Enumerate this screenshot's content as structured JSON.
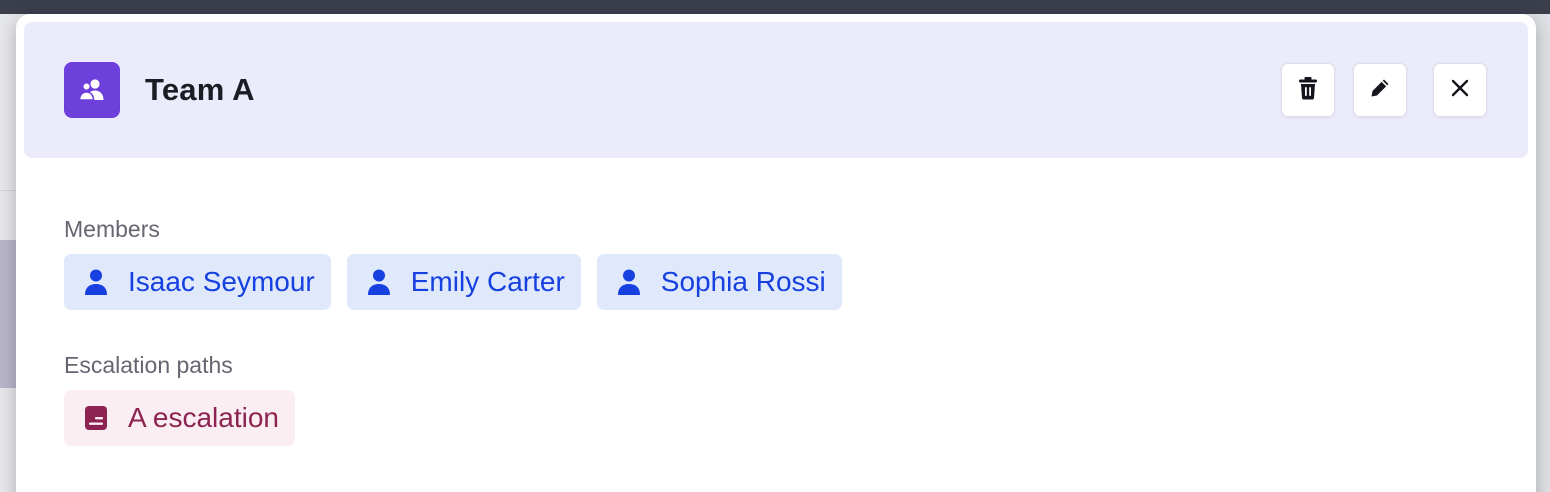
{
  "team": {
    "name": "Team A",
    "icon": "team-users-icon"
  },
  "header_actions": {
    "delete_icon": "trash-icon",
    "edit_icon": "pencil-icon",
    "close_icon": "close-icon"
  },
  "members": {
    "label": "Members",
    "items": [
      {
        "name": "Isaac Seymour",
        "icon": "user-icon"
      },
      {
        "name": "Emily Carter",
        "icon": "user-icon"
      },
      {
        "name": "Sophia Rossi",
        "icon": "user-icon"
      }
    ]
  },
  "escalation_paths": {
    "label": "Escalation paths",
    "items": [
      {
        "name": "A escalation",
        "icon": "escalation-path-icon"
      }
    ]
  },
  "colors": {
    "header_bg": "#ebebfb",
    "team_icon_bg": "#6d3fdb",
    "user_chip_bg": "#dfe9fb",
    "user_chip_text": "#1640e0",
    "escalation_chip_bg": "#fbeef2",
    "escalation_chip_text": "#8c2350"
  }
}
